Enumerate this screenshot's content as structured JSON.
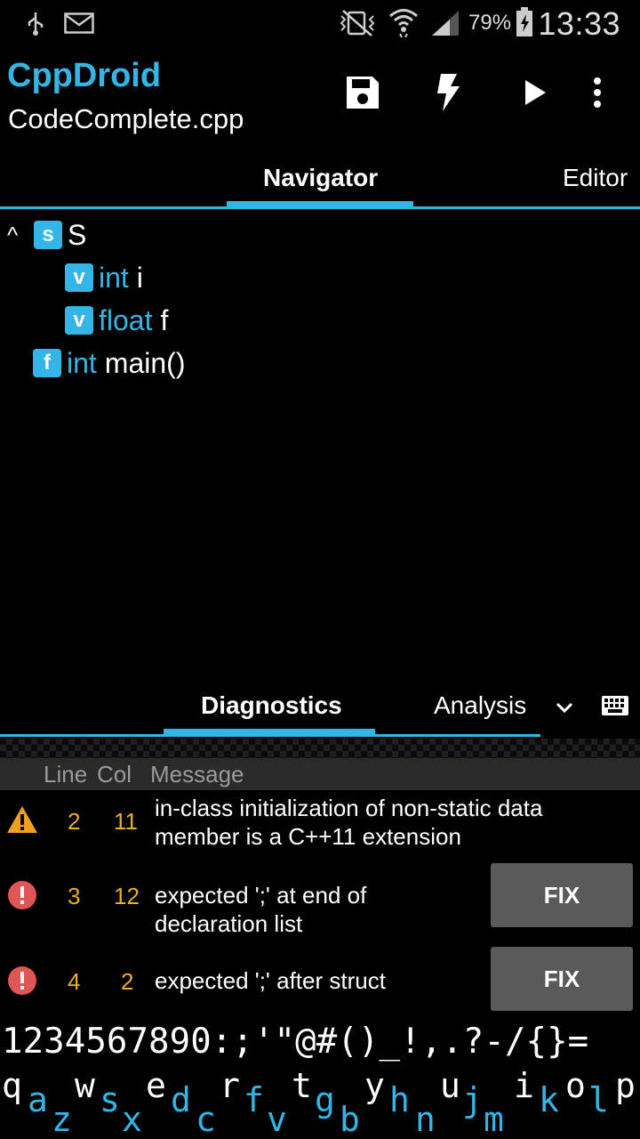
{
  "status_bar": {
    "battery_percent": "79%",
    "time": "13:33",
    "icons": [
      "usb-icon",
      "mail-icon",
      "mute-vibrate-icon",
      "wifi-icon",
      "signal-icon",
      "battery-charging-icon"
    ]
  },
  "app_bar": {
    "title": "CppDroid",
    "subtitle": "CodeComplete.cpp",
    "actions": [
      "save-icon",
      "flash-icon",
      "run-icon",
      "overflow-menu-icon"
    ]
  },
  "top_tabs": {
    "navigator": "Navigator",
    "editor": "Editor"
  },
  "navigator": {
    "collapse_glyph": "^",
    "items": [
      {
        "badge": "s",
        "keyword": "",
        "name": "S"
      },
      {
        "badge": "v",
        "keyword": "int",
        "name": "i"
      },
      {
        "badge": "v",
        "keyword": "float",
        "name": "f"
      },
      {
        "badge": "f",
        "keyword": "int",
        "name": "main()"
      }
    ]
  },
  "bottom_tabs": {
    "diagnostics": "Diagnostics",
    "analysis": "Analysis"
  },
  "diagnostics": {
    "columns": {
      "line": "Line",
      "col": "Col",
      "message": "Message"
    },
    "rows": [
      {
        "severity": "warning",
        "line": "2",
        "col": "11",
        "message_1": "in-class initialization of non-static data",
        "message_2": "member is a C++11 extension",
        "fix": ""
      },
      {
        "severity": "error",
        "line": "3",
        "col": "12",
        "message_1": "expected ';' at end of",
        "message_2": "declaration list",
        "fix": "FIX"
      },
      {
        "severity": "error",
        "line": "4",
        "col": "2",
        "message_1": "expected ';' after struct",
        "message_2": "",
        "fix": "FIX"
      }
    ]
  },
  "keyboard": {
    "symbols_row": "1234567890:;'\"@#()_!,.?-/{}=",
    "top_letters": [
      "q",
      "w",
      "e",
      "r",
      "t",
      "y",
      "u",
      "i",
      "o",
      "p"
    ],
    "bottom_letters": [
      "a",
      "z",
      "s",
      "x",
      "d",
      "c",
      "f",
      "v",
      "g",
      "b",
      "h",
      "n",
      "j",
      "m",
      "k",
      "l"
    ]
  },
  "colors": {
    "accent": "#33b5e5",
    "warning": "#f0a020",
    "error": "#e05555",
    "numbers": "#e8b020"
  }
}
